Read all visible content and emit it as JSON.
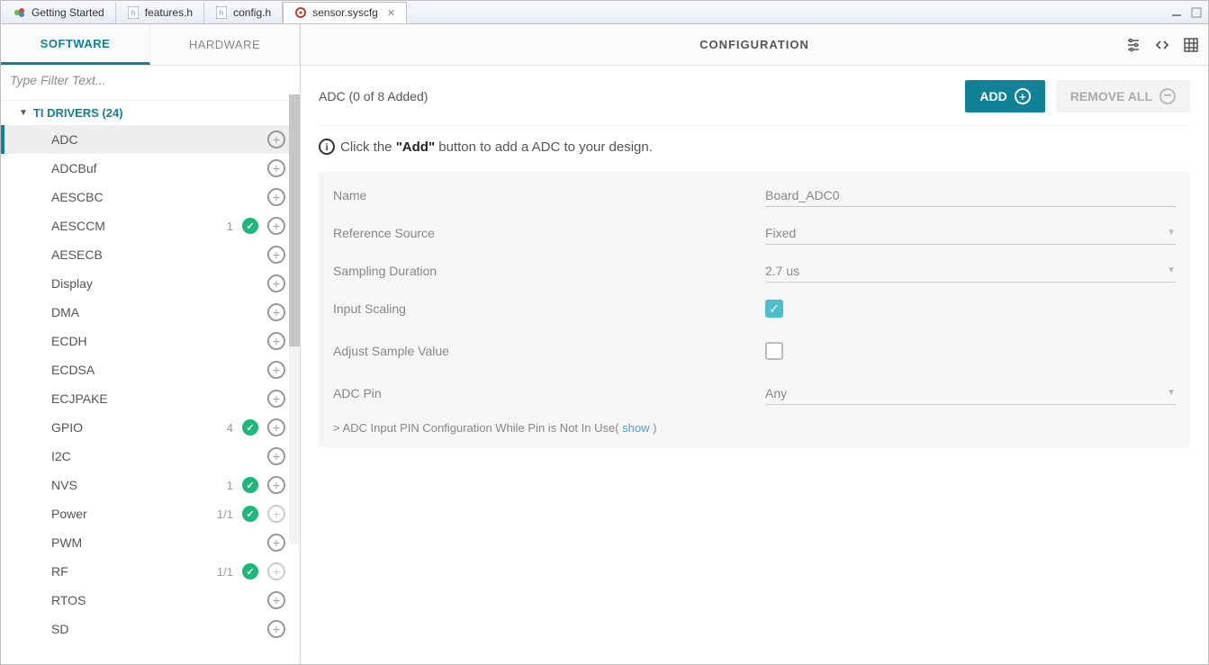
{
  "tabs": {
    "items": [
      {
        "label": "Getting Started",
        "icon": "getting-started"
      },
      {
        "label": "features.h",
        "icon": "h-file"
      },
      {
        "label": "config.h",
        "icon": "h-file"
      },
      {
        "label": "sensor.syscfg",
        "icon": "cfg-file",
        "active": true,
        "closable": true
      }
    ]
  },
  "subtabs": {
    "software": "SOFTWARE",
    "hardware": "HARDWARE"
  },
  "filter_placeholder": "Type Filter Text...",
  "tree_header": "TI DRIVERS (24)",
  "tree_items": [
    {
      "name": "ADC",
      "selected": true
    },
    {
      "name": "ADCBuf"
    },
    {
      "name": "AESCBC"
    },
    {
      "name": "AESCCM",
      "count": "1",
      "tick": true
    },
    {
      "name": "AESECB"
    },
    {
      "name": "Display"
    },
    {
      "name": "DMA"
    },
    {
      "name": "ECDH"
    },
    {
      "name": "ECDSA"
    },
    {
      "name": "ECJPAKE"
    },
    {
      "name": "GPIO",
      "count": "4",
      "tick": true
    },
    {
      "name": "I2C"
    },
    {
      "name": "NVS",
      "count": "1",
      "tick": true
    },
    {
      "name": "Power",
      "count": "1/1",
      "tick": true,
      "plus_disabled": true
    },
    {
      "name": "PWM"
    },
    {
      "name": "RF",
      "count": "1/1",
      "tick": true,
      "plus_disabled": true
    },
    {
      "name": "RTOS"
    },
    {
      "name": "SD"
    }
  ],
  "config": {
    "header_title": "CONFIGURATION",
    "summary": "ADC (0 of 8 Added)",
    "add_label": "ADD",
    "remove_label": "REMOVE ALL",
    "info_prefix": "Click the ",
    "info_bold": "\"Add\"",
    "info_suffix": " button to add a ADC to your design.",
    "fields": {
      "name_label": "Name",
      "name_value": "Board_ADC0",
      "ref_label": "Reference Source",
      "ref_value": "Fixed",
      "samp_label": "Sampling Duration",
      "samp_value": "2.7 us",
      "inscale_label": "Input Scaling",
      "adjust_label": "Adjust Sample Value",
      "pin_label": "ADC Pin",
      "pin_value": "Any"
    },
    "expander": {
      "prefix": "> ADC Input PIN Configuration While Pin is Not In Use( ",
      "link": "show",
      "suffix": " )"
    }
  }
}
